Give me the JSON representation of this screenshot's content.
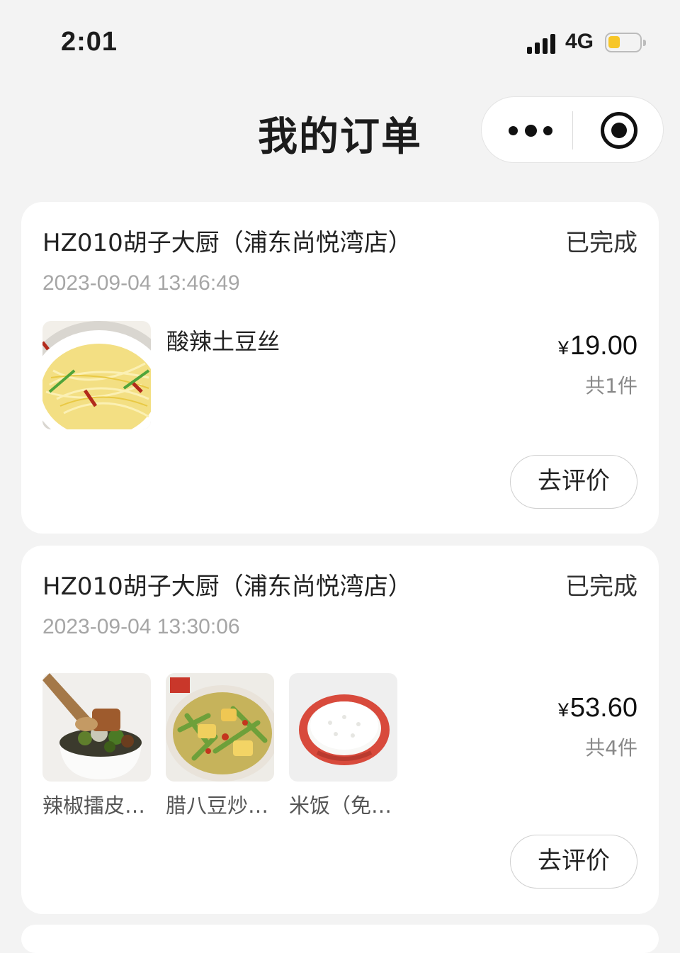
{
  "status_bar": {
    "time": "2:01",
    "network": "4G",
    "battery_level": 0.3
  },
  "nav": {
    "title": "我的订单",
    "more_icon": "more-dots-icon",
    "close_icon": "target-circle-icon"
  },
  "orders": [
    {
      "store": "HZ010胡子大厨（浦东尚悦湾店）",
      "status": "已完成",
      "datetime": "2023-09-04 13:46:49",
      "item_name": "酸辣土豆丝",
      "currency": "¥",
      "amount": "19.00",
      "count": "共1件",
      "action": "去评价"
    },
    {
      "store": "HZ010胡子大厨（浦东尚悦湾店）",
      "status": "已完成",
      "datetime": "2023-09-04 13:30:06",
      "items": [
        {
          "name": "辣椒擂皮…"
        },
        {
          "name": "腊八豆炒…"
        },
        {
          "name": "米饭（免…"
        }
      ],
      "currency": "¥",
      "amount": "53.60",
      "count": "共4件",
      "action": "去评价"
    }
  ]
}
